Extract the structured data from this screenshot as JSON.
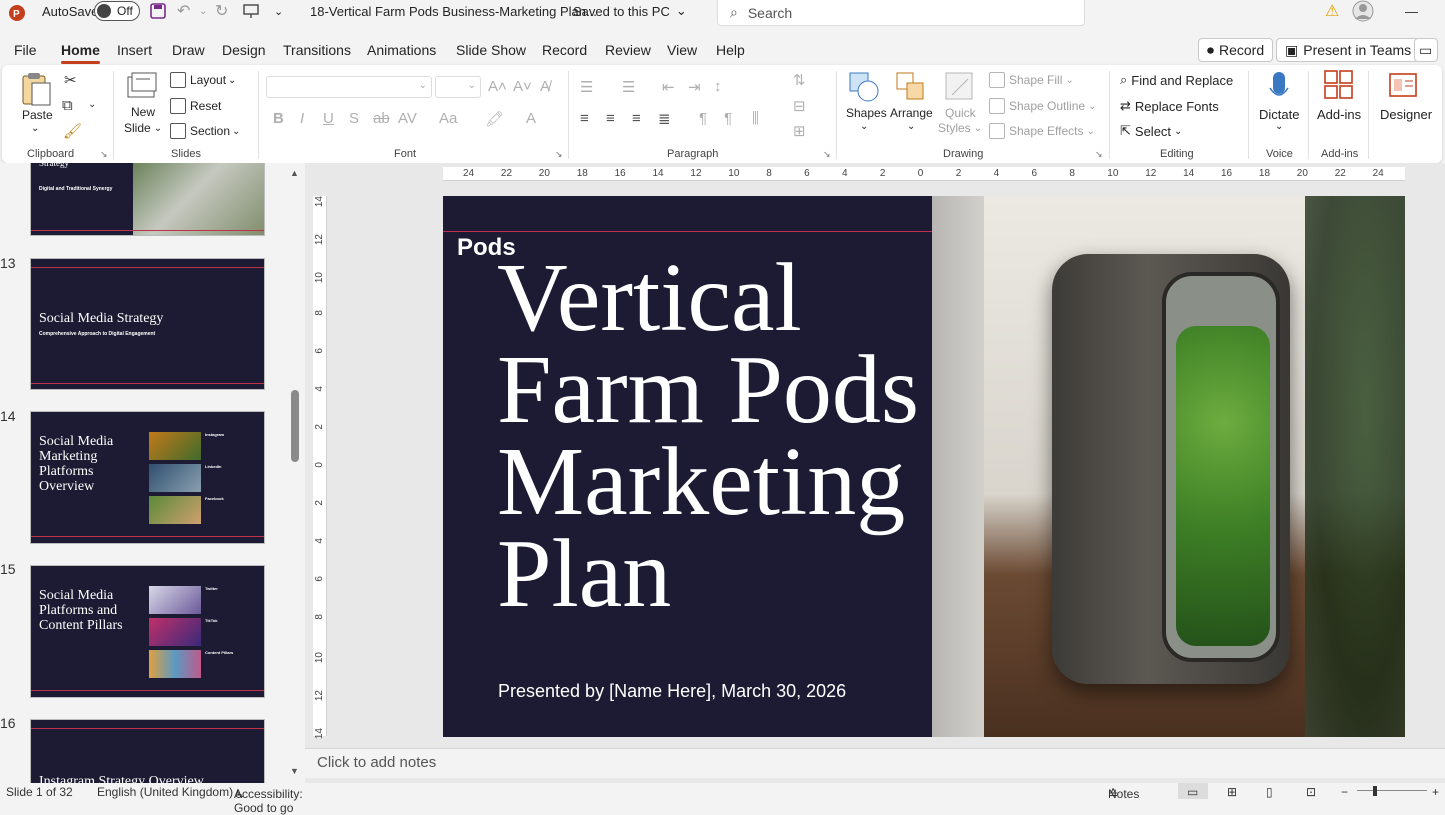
{
  "titlebar": {
    "autosave_label": "AutoSave",
    "autosave_state": "Off",
    "doc_title": "18-Vertical Farm Pods Business-Marketing Plan...",
    "save_status": "Saved to this PC",
    "search_placeholder": "Search"
  },
  "tabs": [
    "File",
    "Home",
    "Insert",
    "Draw",
    "Design",
    "Transitions",
    "Animations",
    "Slide Show",
    "Record",
    "Review",
    "View",
    "Help"
  ],
  "active_tab": "Home",
  "top_buttons": {
    "record": "Record",
    "present": "Present in Teams"
  },
  "ribbon": {
    "clipboard": {
      "label": "Clipboard",
      "paste": "Paste"
    },
    "slides": {
      "label": "Slides",
      "new_slide": "New",
      "new_slide2": "Slide",
      "layout": "Layout",
      "reset": "Reset",
      "section": "Section"
    },
    "font": {
      "label": "Font"
    },
    "paragraph": {
      "label": "Paragraph"
    },
    "drawing": {
      "label": "Drawing",
      "shapes": "Shapes",
      "arrange": "Arrange",
      "quick": "Quick",
      "styles": "Styles",
      "shape_fill": "Shape Fill",
      "shape_outline": "Shape Outline",
      "shape_effects": "Shape Effects"
    },
    "editing": {
      "label": "Editing",
      "find_replace": "Find and Replace",
      "replace_fonts": "Replace Fonts",
      "select": "Select"
    },
    "voice": {
      "label": "Voice",
      "dictate": "Dictate"
    },
    "addins": {
      "label": "Add-ins",
      "addins_btn": "Add-ins"
    },
    "designer": {
      "label": "Designer"
    }
  },
  "thumbnails": [
    {
      "num": "",
      "title": "Strategy",
      "sub": "Digital and Traditional Synergy"
    },
    {
      "num": "13",
      "title": "Social Media Strategy",
      "sub": "Comprehensive Approach to Digital Engagement"
    },
    {
      "num": "14",
      "title": "Social Media Marketing Platforms Overview",
      "items": [
        "Instagram",
        "LinkedIn",
        "Facebook"
      ]
    },
    {
      "num": "15",
      "title": "Social Media Platforms and Content Pillars",
      "items": [
        "Twitter",
        "TikTok",
        "Content Pillars"
      ]
    },
    {
      "num": "16",
      "title": "Instagram Strategy Overview"
    }
  ],
  "ruler": {
    "h_ticks": [
      "24",
      "22",
      "20",
      "18",
      "16",
      "14",
      "12",
      "10",
      "8",
      "6",
      "4",
      "2",
      "0",
      "2",
      "4",
      "6",
      "8",
      "10",
      "12",
      "14",
      "16",
      "18",
      "20",
      "22",
      "24"
    ],
    "v_ticks": [
      "14",
      "12",
      "10",
      "8",
      "6",
      "4",
      "2",
      "0",
      "2",
      "4",
      "6",
      "8",
      "10",
      "12",
      "14"
    ]
  },
  "slide": {
    "tag": "Pods",
    "title": "Vertical Farm Pods Marketing Plan",
    "presenter": "Presented by [Name Here], March 30, 2026"
  },
  "notes_placeholder": "Click to add notes",
  "status": {
    "slide_pos": "Slide 1 of 32",
    "language": "English (United Kingdom)",
    "accessibility": "Accessibility: Good to go",
    "notes_btn": "Notes"
  },
  "colors": {
    "accent": "#c43e1c",
    "slide_bg": "#1c1b33",
    "slide_line": "#c0304a"
  }
}
